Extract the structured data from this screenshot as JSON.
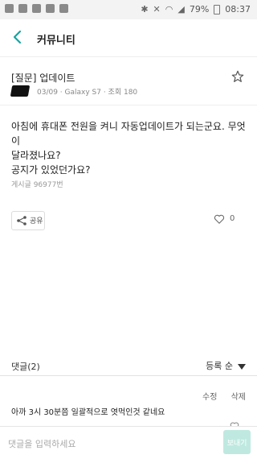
{
  "status_bar": {
    "battery": "79%",
    "time": "08:37"
  },
  "app_bar": {
    "title": "커뮤니티",
    "back_icon": "arrow-left-icon"
  },
  "post": {
    "title": "[질문] 업데이트",
    "meta": "03/09 · Galaxy S7 · 조회 180",
    "body": [
      "아침에 휴대폰 전원을 켜니 자동업데이트가 되는군요. 무엇이",
      "달라졌나요?",
      "공지가 있었던가요?"
    ],
    "views": "게시글 96977번",
    "share_label": "공유",
    "like_count": "0",
    "bookmark_icon": "star-outline-icon"
  },
  "comments": {
    "count_label": "댓글(2)",
    "sort_label": "등록 순",
    "actions": {
      "edit": "수정",
      "delete": "삭제"
    },
    "first_comment": "아까 3시 30분쯤 일괄적으로 엿먹인것 같네요"
  },
  "input": {
    "placeholder": "댓글을 입력하세요",
    "send_label": "보내기"
  },
  "colors": {
    "accent": "#1aa3a0",
    "send_button": "#bfe9e0"
  }
}
